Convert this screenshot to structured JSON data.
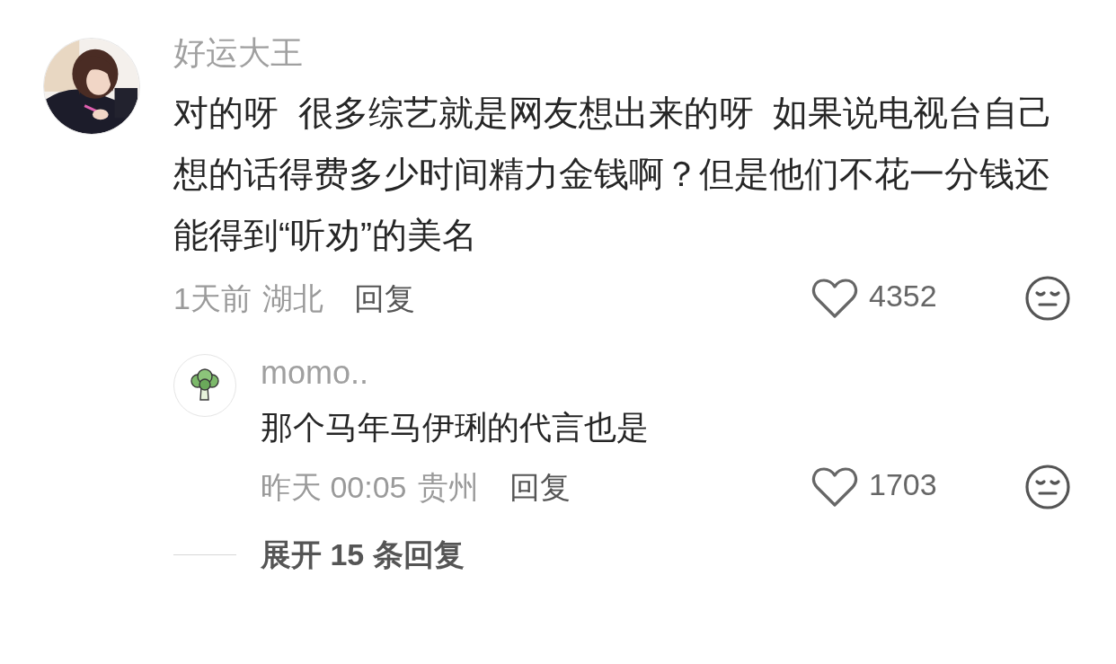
{
  "comments": [
    {
      "username": "好运大王",
      "text": "对的呀  很多综艺就是网友想出来的呀  如果说电视台自己想的话得费多少时间精力金钱啊？但是他们不花一分钱还能得到“听劝”的美名",
      "time": "1天前",
      "location": "湖北",
      "reply_label": "回复",
      "likes": "4352",
      "liked": false,
      "replies": [
        {
          "username": "momo..",
          "text": "那个马年马伊琍的代言也是",
          "time": "昨天 00:05",
          "location": "贵州",
          "reply_label": "回复",
          "likes": "1703",
          "liked": false
        }
      ],
      "expand_label": "展开 15 条回复"
    }
  ]
}
